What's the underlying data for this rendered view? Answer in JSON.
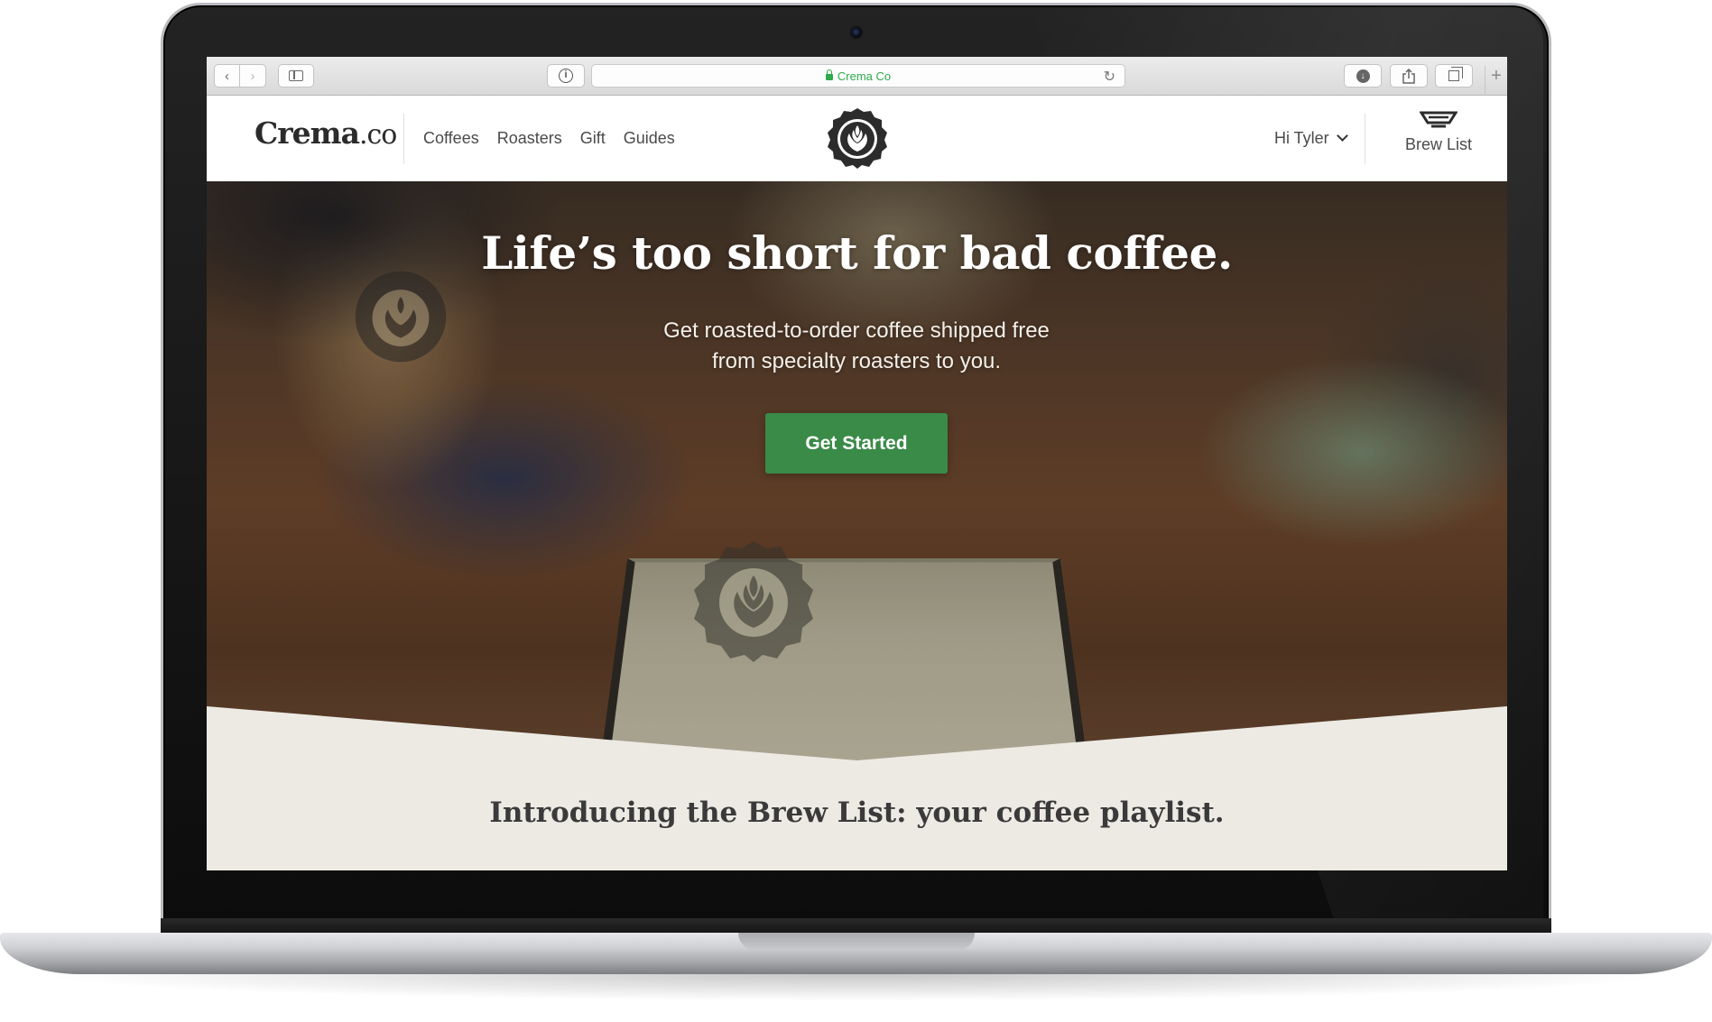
{
  "browser": {
    "url_label": "Crema Co",
    "icons": [
      "back-icon",
      "forward-icon",
      "sidebar-icon",
      "info-icon",
      "lock-icon",
      "reload-icon",
      "download-icon",
      "share-icon",
      "tabs-icon",
      "new-tab-icon"
    ]
  },
  "header": {
    "logo_main": "Crema",
    "logo_suffix": ".co",
    "nav": [
      "Coffees",
      "Roasters",
      "Gift",
      "Guides"
    ],
    "greeting": "Hi Tyler",
    "brew_list": "Brew List"
  },
  "hero": {
    "title": "Life’s too short for bad coffee.",
    "subtitle_line1": "Get roasted-to-order coffee shipped free",
    "subtitle_line2": "from specialty roasters to you.",
    "cta": "Get Started"
  },
  "intro": {
    "heading": "Introducing the Brew List: your coffee playlist."
  },
  "colors": {
    "brand_green": "#3a8a48",
    "ssl_green": "#2eaa4b",
    "cream": "#edeae4",
    "text_dark": "#2b2b2b"
  }
}
